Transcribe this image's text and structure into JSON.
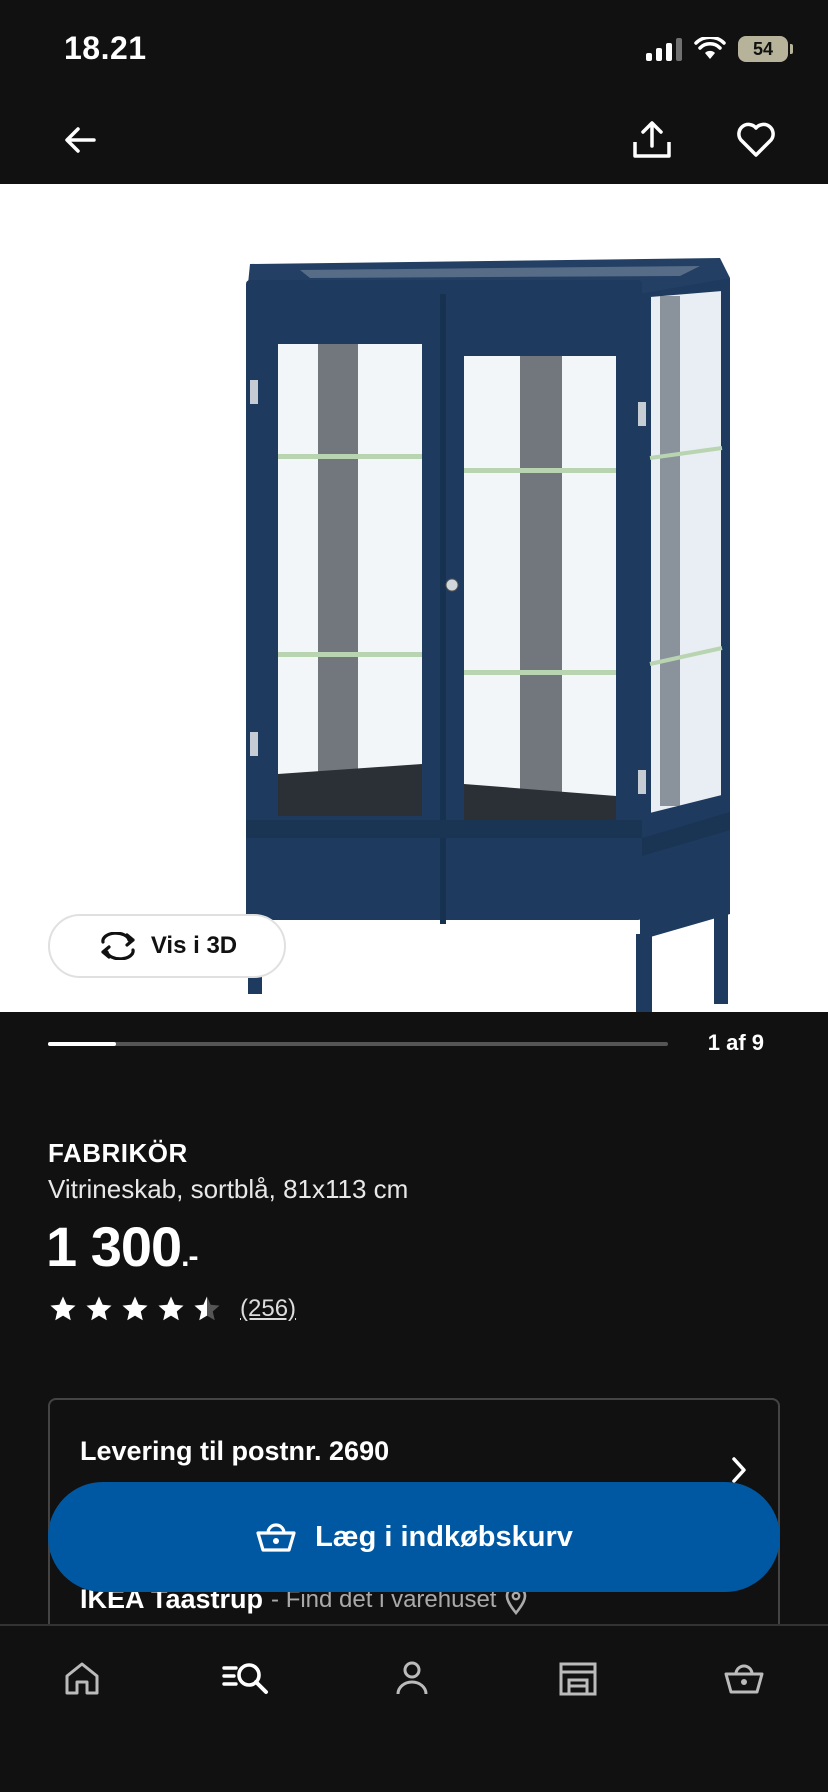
{
  "status_bar": {
    "time": "18.21",
    "battery": "54"
  },
  "top_nav": {
    "back_icon": "arrow-left-icon",
    "share_icon": "share-icon",
    "favorite_icon": "heart-icon"
  },
  "image": {
    "view_3d_label": "Vis i 3D",
    "view_3d_icon": "rotate-icon"
  },
  "carousel": {
    "counter": "1 af 9",
    "progress": 0.11
  },
  "product": {
    "name": "FABRIKÖR",
    "description": "Vitrineskab, sortblå, 81x113 cm",
    "price": "1 300",
    "price_suffix": ".-",
    "rating": 4.5,
    "review_count": "(256)"
  },
  "delivery": {
    "title": "Levering til postnr. 2690",
    "store_name": "IKEA Taastrup",
    "store_sub": "- Find det i varehuset"
  },
  "cart_button": {
    "label": "Læg i indkøbskurv",
    "icon": "basket-icon"
  },
  "tabs": [
    {
      "name": "home",
      "icon": "home-icon"
    },
    {
      "name": "search",
      "icon": "search-icon"
    },
    {
      "name": "profile",
      "icon": "profile-icon"
    },
    {
      "name": "stores",
      "icon": "store-icon"
    },
    {
      "name": "cart",
      "icon": "basket-icon"
    }
  ],
  "colors": {
    "background": "#111111",
    "accent": "#0058a3",
    "cabinet": "#1f3a5f"
  }
}
